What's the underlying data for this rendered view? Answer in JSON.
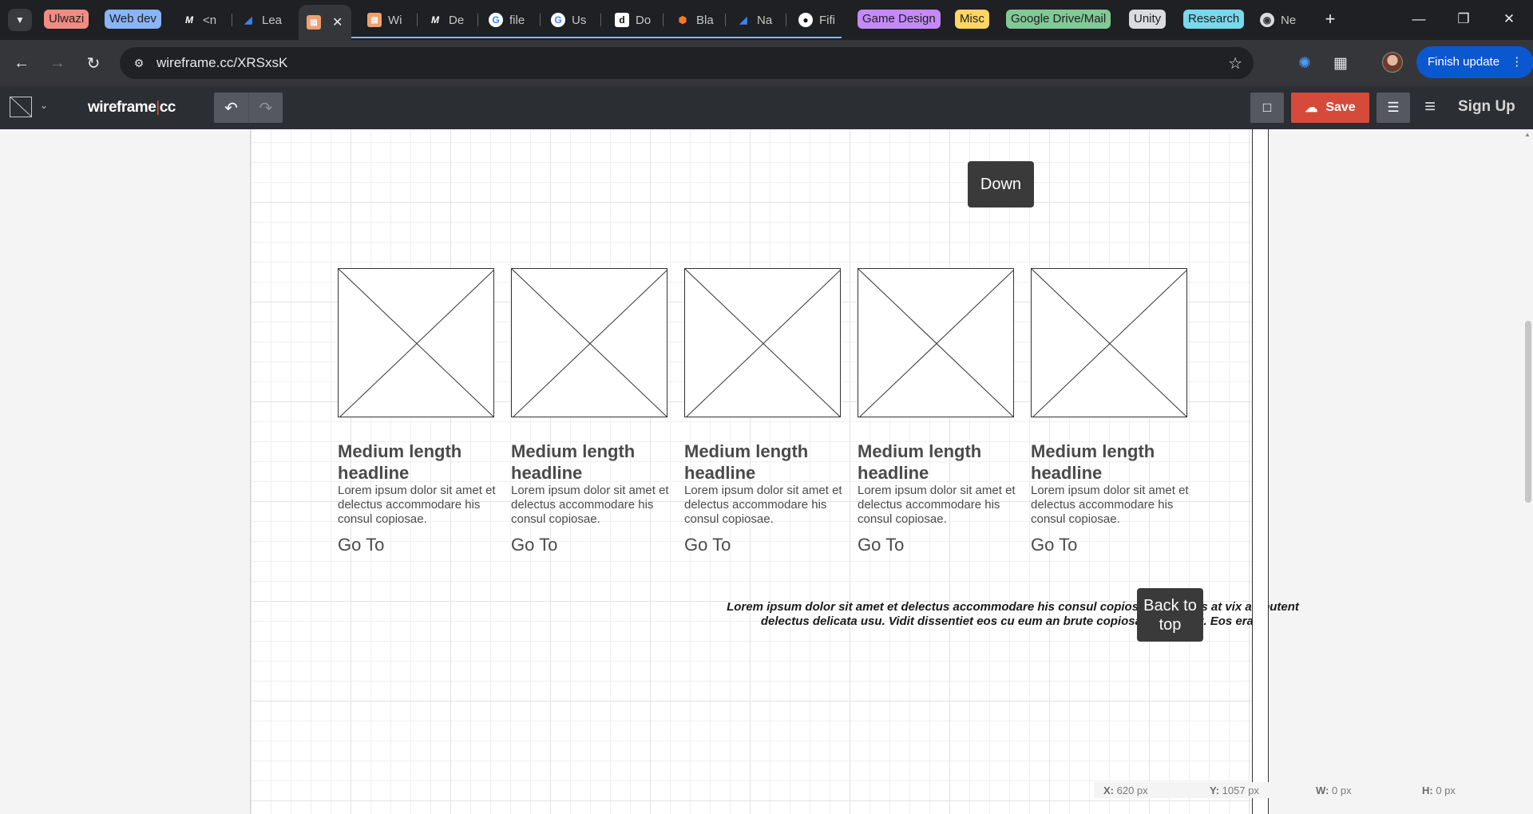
{
  "browser": {
    "groups": [
      {
        "label": "Ulwazi",
        "color": "#f28b82"
      },
      {
        "label": "Web dev",
        "color": "#8ab4f8"
      },
      {
        "label": "Game Design",
        "color": "#c58af9"
      },
      {
        "label": "Misc",
        "color": "#fdd663"
      },
      {
        "label": "Google Drive/Mail",
        "color": "#81c995"
      },
      {
        "label": "Unity",
        "color": "#dadce0"
      },
      {
        "label": "Research",
        "color": "#78d9ec"
      }
    ],
    "tabs": [
      {
        "title": "<n",
        "icon": "m-logo-icon"
      },
      {
        "title": "Lea",
        "icon": "arrow-logo-icon"
      },
      {
        "title": "",
        "icon": "wireframe-logo-icon"
      },
      {
        "title": "Wi",
        "icon": "wireframe-logo-icon"
      },
      {
        "title": "De",
        "icon": "m-logo-icon"
      },
      {
        "title": "file",
        "icon": "google-icon"
      },
      {
        "title": "Us",
        "icon": "google-icon"
      },
      {
        "title": "Do",
        "icon": "doc-logo-icon"
      },
      {
        "title": "Bla",
        "icon": "blender-icon"
      },
      {
        "title": "Na",
        "icon": "arrow-logo-icon"
      },
      {
        "title": "Fifi",
        "icon": "github-icon"
      },
      {
        "title": "Ne",
        "icon": "chrome-icon"
      }
    ],
    "url": "wireframe.cc/XRSxsK",
    "finish_update": "Finish update"
  },
  "app": {
    "brand_left": "wireframe",
    "brand_sep": "|",
    "brand_right": "cc",
    "save_label": "Save",
    "signup_label": "Sign Up"
  },
  "canvas": {
    "down_label": "Down",
    "back_top_label": "Back to top",
    "cards": [
      {
        "headline": "Medium length headline",
        "body": "Lorem ipsum dolor sit amet et delectus accommodare his consul copiosae.",
        "link": "Go To"
      },
      {
        "headline": "Medium length headline",
        "body": "Lorem ipsum dolor sit amet et delectus accommodare his consul copiosae.",
        "link": "Go To"
      },
      {
        "headline": "Medium length headline",
        "body": "Lorem ipsum dolor sit amet et delectus accommodare his consul copiosae.",
        "link": "Go To"
      },
      {
        "headline": "Medium length headline",
        "body": "Lorem ipsum dolor sit amet et delectus accommodare his consul copiosae.",
        "link": "Go To"
      },
      {
        "headline": "Medium length headline",
        "body": "Lorem ipsum dolor sit amet et delectus accommodare his consul copiosae.",
        "link": "Go To"
      }
    ],
    "footer": "Lorem ipsum dolor sit amet et delectus accommodare his consul copiosae legendos at vix ad putent delectus delicata usu. Vidit dissentiet eos cu eum an brute copiosae hendrerit. Eos erant"
  },
  "status": {
    "x_label": "X:",
    "x_value": "620 px",
    "y_label": "Y:",
    "y_value": "1057 px",
    "w_label": "W:",
    "w_value": "0 px",
    "h_label": "H:",
    "h_value": "0 px"
  }
}
